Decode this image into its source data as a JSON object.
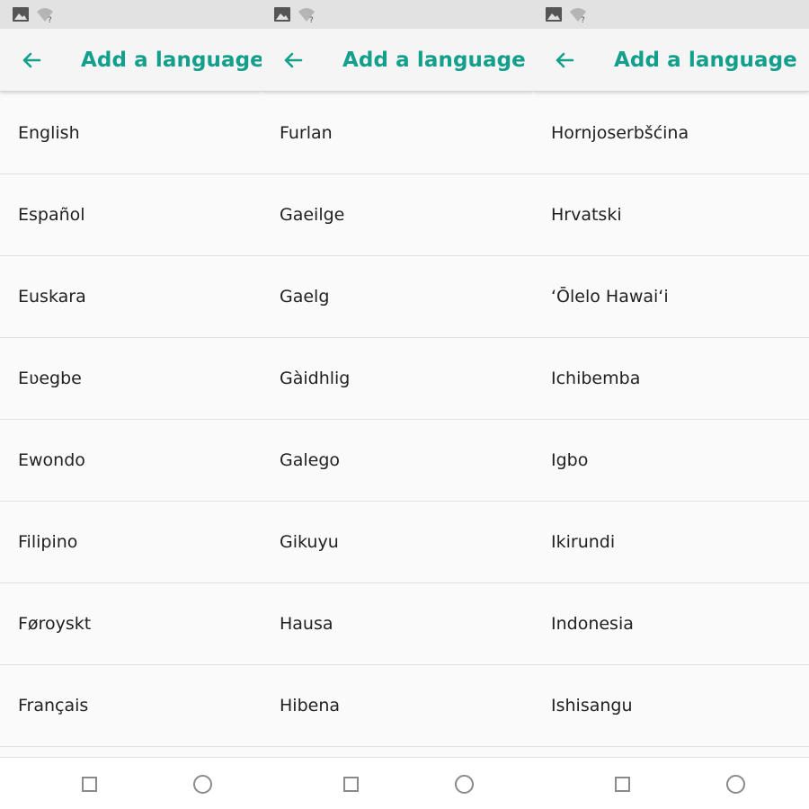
{
  "colors": {
    "accent": "#129f8b",
    "status_bar": "#e2e2e2",
    "text": "#212121"
  },
  "icons": {
    "status_image": "image-icon",
    "status_wifi": "wifi-unknown-icon",
    "back": "arrow-left-icon",
    "recents": "square-icon",
    "home": "circle-icon"
  },
  "panels": [
    {
      "title": "Add a language",
      "items": [
        "English",
        "Español",
        "Euskara",
        "Eʋegbe",
        "Ewondo",
        "Filipino",
        "Føroyskt",
        "Français"
      ]
    },
    {
      "title": "Add a language",
      "items": [
        "Furlan",
        "Gaeilge",
        "Gaelg",
        "Gàidhlig",
        "Galego",
        "Gikuyu",
        "Hausa",
        "Hibena"
      ]
    },
    {
      "title": "Add a language",
      "items": [
        "Hornjoserbšćina",
        "Hrvatski",
        "ʻŌlelo Hawaiʻi",
        "Ichibemba",
        "Igbo",
        "Ikirundi",
        "Indonesia",
        "Ishisangu"
      ]
    }
  ]
}
